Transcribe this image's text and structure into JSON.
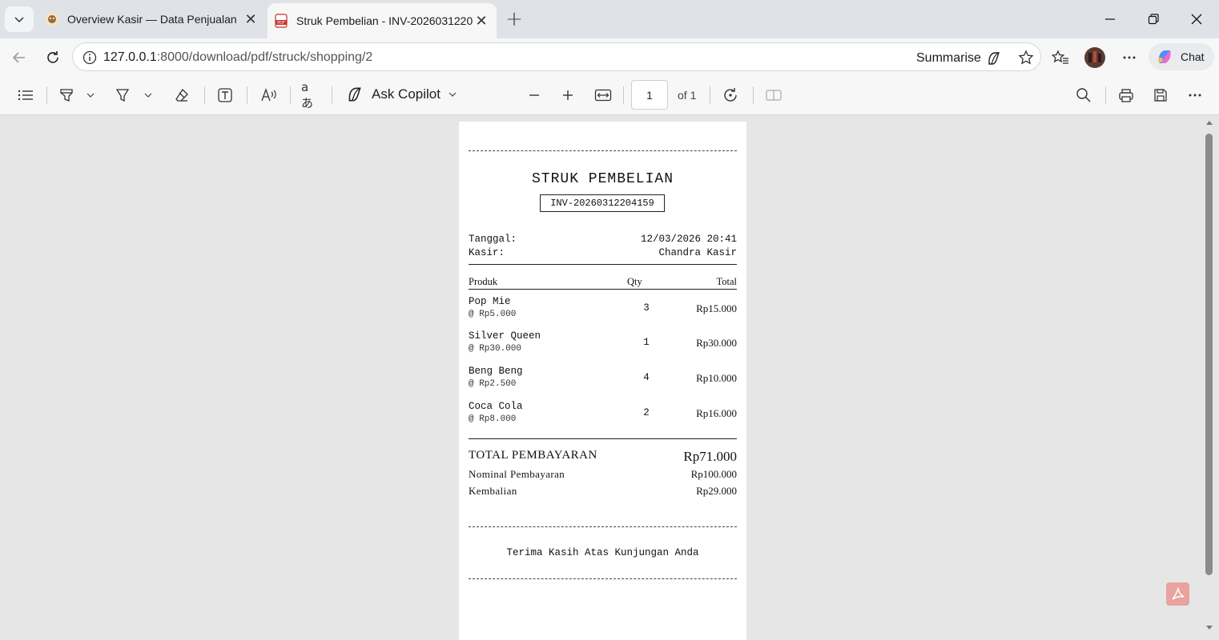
{
  "browser": {
    "tabs": [
      {
        "title": "Overview Kasir — Data Penjualan",
        "active": false,
        "favicon": "cat-favicon-icon"
      },
      {
        "title": "Struk Pembelian - INV-20260312204159",
        "active": true,
        "favicon": "pdf-icon"
      }
    ],
    "url_host": "127.0.0.1",
    "url_path": ":8000/download/pdf/struck/shopping/2",
    "summarise_label": "Summarise",
    "chat_label": "Chat"
  },
  "pdf_toolbar": {
    "ask_copilot_label": "Ask Copilot",
    "page_number": "1",
    "page_count_label": "of 1"
  },
  "receipt": {
    "title": "STRUK PEMBELIAN",
    "invoice": "INV-20260312204159",
    "date_label": "Tanggal:",
    "date_value": "12/03/2026 20:41",
    "cashier_label": "Kasir:",
    "cashier_value": "Chandra Kasir",
    "col_product": "Produk",
    "col_qty": "Qty",
    "col_total": "Total",
    "items": [
      {
        "name": "Pop Mie",
        "unit_price": "@ Rp5.000",
        "qty": "3",
        "total": "Rp15.000"
      },
      {
        "name": "Silver Queen",
        "unit_price": "@ Rp30.000",
        "qty": "1",
        "total": "Rp30.000"
      },
      {
        "name": "Beng Beng",
        "unit_price": "@ Rp2.500",
        "qty": "4",
        "total": "Rp10.000"
      },
      {
        "name": "Coca Cola",
        "unit_price": "@ Rp8.000",
        "qty": "2",
        "total": "Rp16.000"
      }
    ],
    "total_label": "TOTAL PEMBAYARAN",
    "total_value": "Rp71.000",
    "paid_label": "Nominal Pembayaran",
    "paid_value": "Rp100.000",
    "change_label": "Kembalian",
    "change_value": "Rp29.000",
    "thanks": "Terima Kasih Atas Kunjungan Anda"
  }
}
